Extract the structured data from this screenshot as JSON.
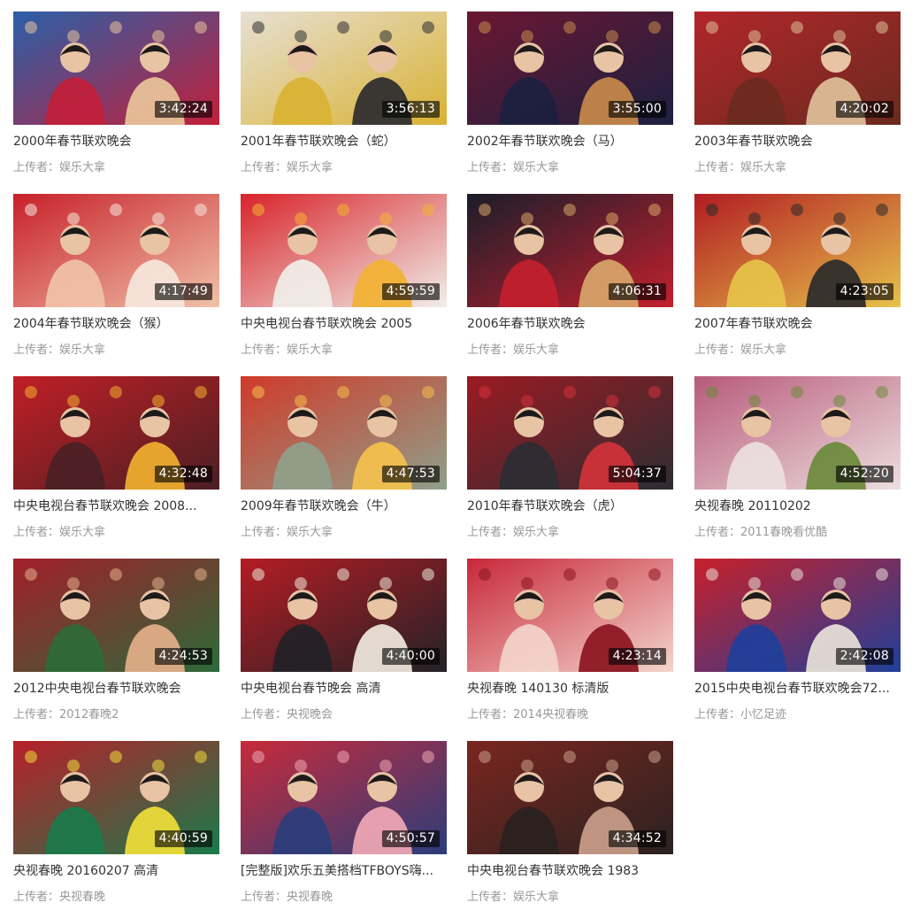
{
  "uploader_prefix": "上传者：",
  "videos": [
    {
      "title": "2000年春节联欢晚会",
      "duration": "3:42:24",
      "uploader": "娱乐大拿",
      "colors": [
        "#2a5fa8",
        "#c2203a",
        "#e9c59a"
      ]
    },
    {
      "title": "2001年春节联欢晚会（蛇）",
      "duration": "3:56:13",
      "uploader": "娱乐大拿",
      "colors": [
        "#e7e0d3",
        "#d9b233",
        "#2b2b2f"
      ]
    },
    {
      "title": "2002年春节联欢晚会（马）",
      "duration": "3:55:00",
      "uploader": "娱乐大拿",
      "colors": [
        "#6a1732",
        "#1c2040",
        "#c88a4a"
      ]
    },
    {
      "title": "2003年春节联欢晚会",
      "duration": "4:20:02",
      "uploader": "娱乐大拿",
      "colors": [
        "#b2262a",
        "#6b2a1f",
        "#e0c09a"
      ]
    },
    {
      "title": "2004年春节联欢晚会（猴）",
      "duration": "4:17:49",
      "uploader": "娱乐大拿",
      "colors": [
        "#c8202a",
        "#f0c2a8",
        "#f6e7dc"
      ]
    },
    {
      "title": "中央电视台春节联欢晚会 2005",
      "duration": "4:59:59",
      "uploader": "娱乐大拿",
      "colors": [
        "#d8232a",
        "#f1efe9",
        "#f2b233"
      ]
    },
    {
      "title": "2006年春节联欢晚会",
      "duration": "4:06:31",
      "uploader": "娱乐大拿",
      "colors": [
        "#1b1d2a",
        "#c3202e",
        "#d8a66a"
      ]
    },
    {
      "title": "2007年春节联欢晚会",
      "duration": "4:23:05",
      "uploader": "娱乐大拿",
      "colors": [
        "#b21c22",
        "#e7c24a",
        "#2a2a2a"
      ]
    },
    {
      "title": "中央电视台春节联欢晚会 2008...",
      "duration": "4:32:48",
      "uploader": "娱乐大拿",
      "colors": [
        "#c01f25",
        "#4a1f24",
        "#f0b030"
      ]
    },
    {
      "title": "2009年春节联欢晚会（牛）",
      "duration": "4:47:53",
      "uploader": "娱乐大拿",
      "colors": [
        "#d03a2a",
        "#8fa08a",
        "#f4c14d"
      ]
    },
    {
      "title": "2010年春节联欢晚会（虎）",
      "duration": "5:04:37",
      "uploader": "娱乐大拿",
      "colors": [
        "#9b1a22",
        "#2d2d33",
        "#d2323a"
      ]
    },
    {
      "title": "央视春晚 20110202",
      "duration": "4:52:20",
      "uploader": "2011春晚看优酷",
      "colors": [
        "#b85a7a",
        "#ecdfe0",
        "#6b8a3a"
      ]
    },
    {
      "title": "2012中央电视台春节联欢晚会",
      "duration": "4:24:53",
      "uploader": "2012春晚2",
      "colors": [
        "#a21f2a",
        "#2c6a3a",
        "#e3b08a"
      ]
    },
    {
      "title": "中央电视台春节晚会 高清",
      "duration": "4:40:00",
      "uploader": "央视晚会",
      "colors": [
        "#b51c24",
        "#222226",
        "#f1e9dc"
      ]
    },
    {
      "title": "央视春晚 140130 标清版",
      "duration": "4:23:14",
      "uploader": "2014央视春晚",
      "colors": [
        "#c8283a",
        "#f3d4cc",
        "#8a1420"
      ]
    },
    {
      "title": "2015中央电视台春节联欢晚会72...",
      "duration": "2:42:08",
      "uploader": "小忆足迹",
      "colors": [
        "#c7202a",
        "#1f3f9a",
        "#e9e2d8"
      ]
    },
    {
      "title": "央视春晚 20160207 高清",
      "duration": "4:40:59",
      "uploader": "央视春晚",
      "colors": [
        "#b8202a",
        "#1a7a4a",
        "#f0de3a"
      ]
    },
    {
      "title": "[完整版]欢乐五美搭档TFBOYS嗨...",
      "duration": "4:50:57",
      "uploader": "央视春晚",
      "colors": [
        "#c82a3a",
        "#2a3d7a",
        "#f1a8b4"
      ]
    },
    {
      "title": "中央电视台春节联欢晚会 1983",
      "duration": "4:34:52",
      "uploader": "娱乐大拿",
      "colors": [
        "#7a2620",
        "#2a2220",
        "#caa08a"
      ]
    }
  ]
}
